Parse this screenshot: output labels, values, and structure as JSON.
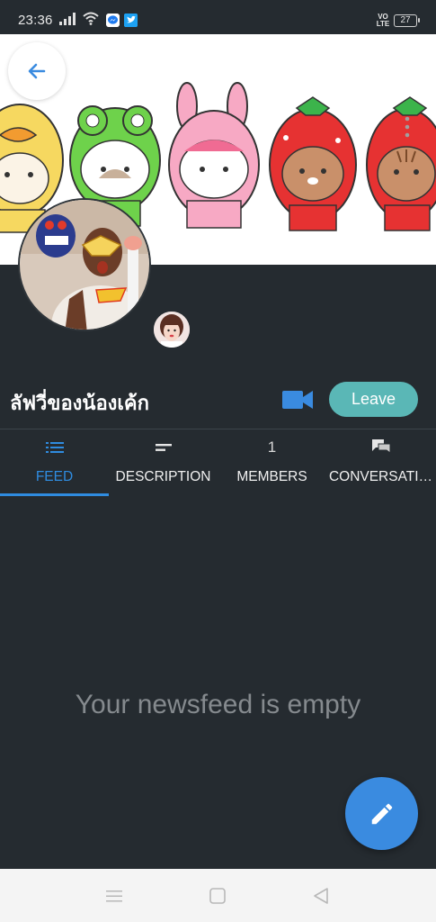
{
  "status_bar": {
    "time": "23:36",
    "network_label": "VO LTE",
    "battery_level": "27",
    "icons": [
      "signal-icon",
      "wifi-icon",
      "messenger-icon",
      "twitter-icon",
      "battery-icon"
    ]
  },
  "header": {
    "back_icon": "arrow-left-icon",
    "menu_icon": "vertical-dots-icon"
  },
  "group": {
    "name": "ลัฟวี่ของน้องเค้ก",
    "leave_label": "Leave",
    "video_icon": "video-camera-icon"
  },
  "tabs": [
    {
      "label": "FEED",
      "icon": "list-icon",
      "active": true
    },
    {
      "label": "DESCRIPTION",
      "icon": "short-text-icon",
      "active": false
    },
    {
      "label": "MEMBERS",
      "count": "1",
      "active": false
    },
    {
      "label": "CONVERSATI…",
      "icon": "chat-bubbles-icon",
      "active": false
    }
  ],
  "feed": {
    "empty_message": "Your newsfeed is empty"
  },
  "fab": {
    "icon": "pencil-icon"
  },
  "nav_bar": {
    "icons": [
      "menu-icon",
      "home-square-icon",
      "back-triangle-icon"
    ]
  },
  "colors": {
    "background": "#252b30",
    "accent_blue": "#2f8ce0",
    "leave_teal": "#5ab7b6",
    "fab_blue": "#3a8be0",
    "video_blue": "#3a8be0"
  }
}
